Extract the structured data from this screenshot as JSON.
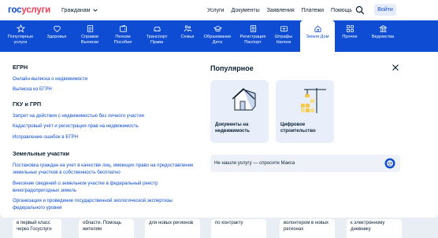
{
  "header": {
    "logo_part1": "гос",
    "logo_part2": "услуги",
    "audience": "Гражданам",
    "nav": [
      "Услуги",
      "Документы",
      "Заявления",
      "Платежи",
      "Помощь"
    ],
    "login": "Войти"
  },
  "categories": [
    {
      "label": "Популярные услуги",
      "icon": "star-icon"
    },
    {
      "label": "Здоровье",
      "icon": "heart-icon"
    },
    {
      "label": "Справки Выписки",
      "icon": "document-icon"
    },
    {
      "label": "Пенсии Пособия",
      "icon": "wallet-icon"
    },
    {
      "label": "Транспорт Права",
      "icon": "car-icon"
    },
    {
      "label": "Семья",
      "icon": "family-icon"
    },
    {
      "label": "Образование Дети",
      "icon": "education-icon"
    },
    {
      "label": "Регистрация Паспорт",
      "icon": "passport-icon"
    },
    {
      "label": "Штрафы Налоги",
      "icon": "fine-icon"
    },
    {
      "label": "Земля Дом",
      "icon": "house-icon"
    },
    {
      "label": "Прочее",
      "icon": "grid-icon"
    },
    {
      "label": "Ведомства",
      "icon": "building-icon"
    }
  ],
  "sections": [
    {
      "title": "ЕГРН",
      "links": [
        "Онлайн-выписка о недвижимости",
        "Выписка из ЕГРН"
      ]
    },
    {
      "title": "ГКУ и ГРП",
      "links": [
        "Запрет на действия с недвижимостью без личного участия",
        "Кадастровый учёт и регистрация прав на недвижимость",
        "Исправление ошибок в ЕГРН"
      ]
    },
    {
      "title": "Земельные участки",
      "links": [
        "Постановка граждан на учет в качестве лиц, имеющих право на предоставление земельных участков в собственность бесплатно",
        "Внесение сведений о земельном участке в федеральный реестр виноградопригодных земель",
        "Организация и проведение государственной экологической экспертизы федерального уровня"
      ]
    }
  ],
  "popular": {
    "title": "Популярное",
    "cards": [
      "Документы на недвижимость",
      "Цифровое строительство"
    ],
    "ask": "Не нашли услугу — спросите Макса"
  },
  "bottom_cards": [
    "в первый класс через Госуслуги",
    "области. Помощь жителям",
    "для новых регионов",
    "по контракту",
    "волонтером в новых регионах",
    "к электронному дневнику"
  ],
  "colors": {
    "brand_blue": "#0d4cd3",
    "brand_red": "#ee3f58",
    "text": "#0b1f33"
  }
}
